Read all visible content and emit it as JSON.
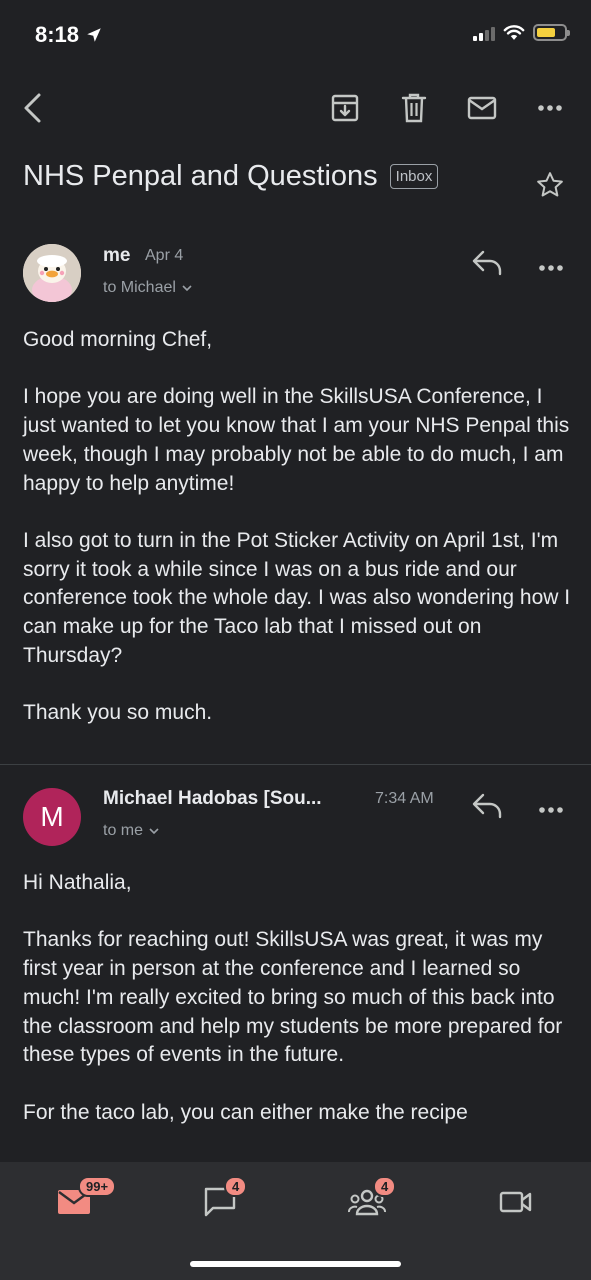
{
  "status": {
    "time": "8:18"
  },
  "email": {
    "subject": "NHS Penpal and Questions",
    "label": "Inbox"
  },
  "messages": [
    {
      "sender": "me",
      "date": "Apr 4",
      "to": "to Michael",
      "avatar": "duck-doll-photo",
      "paragraphs": [
        "Good morning Chef,",
        "I hope you are doing well in the SkillsUSA Conference, I just wanted to let you know that I am your NHS Penpal this week, though I may probably not be able to do much, I am happy to help anytime!",
        "I also got to turn in the Pot Sticker Activity on April 1st, I'm sorry it took a while since I was on a bus ride and our conference took the whole day. I was also wondering how I can make up for the Taco lab that I missed out on Thursday?",
        "Thank you so much."
      ]
    },
    {
      "sender": "Michael Hadobas [Sou...",
      "date": "7:34 AM",
      "to": "to me",
      "avatar_letter": "M",
      "avatar_color": "#b0245a",
      "paragraphs": [
        "Hi Nathalia,",
        "Thanks for reaching out! SkillsUSA was great, it was my first year in person at the conference and I learned so much! I'm really excited to bring so much of this back into the classroom and help my students be more prepared for these types of events in the future.",
        "For the taco lab, you can either make the recipe"
      ]
    }
  ],
  "bottom_nav": [
    {
      "name": "mail",
      "badge": "99+"
    },
    {
      "name": "chat",
      "badge": "4"
    },
    {
      "name": "spaces",
      "badge": "4"
    },
    {
      "name": "meet",
      "badge": ""
    }
  ],
  "colors": {
    "background": "#202124",
    "text": "#e8eaed",
    "secondary": "#9aa0a6",
    "accent": "#f28b82",
    "avatar": "#b0245a"
  }
}
